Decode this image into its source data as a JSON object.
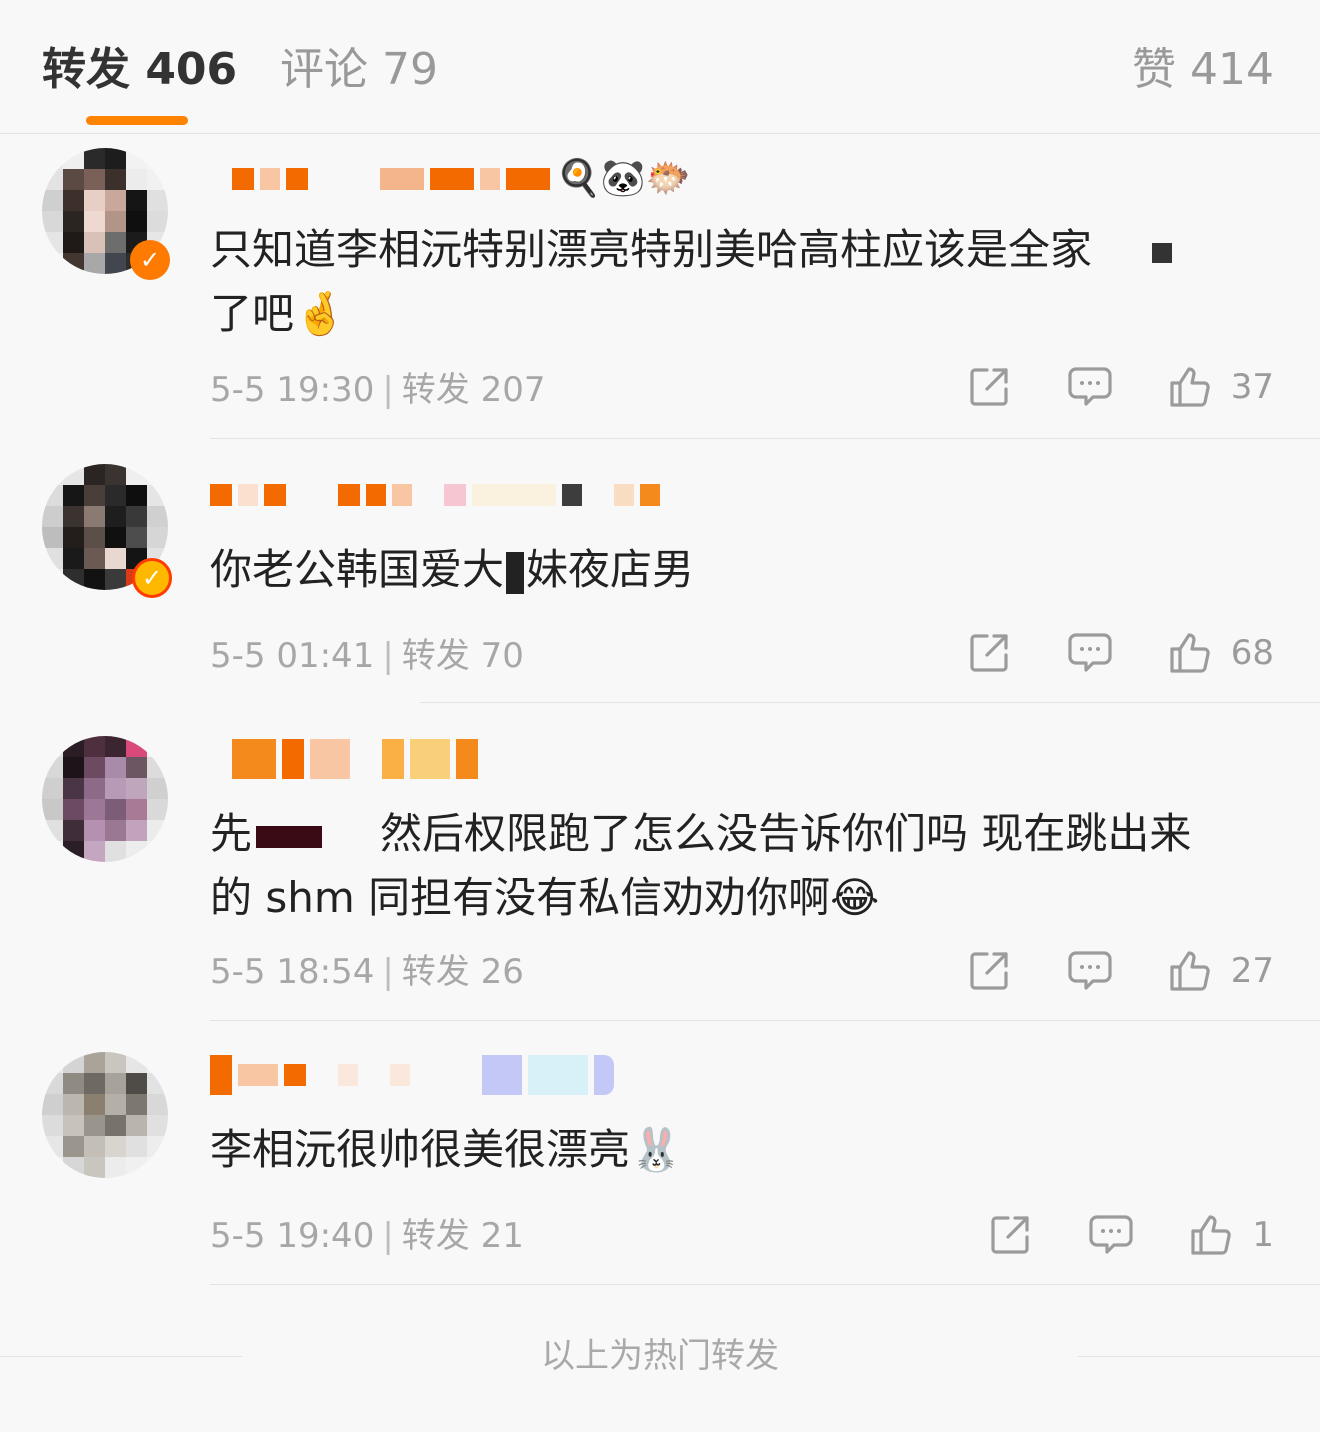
{
  "tabs": {
    "repost": "转发 406",
    "comment": "评论 79",
    "like": "赞 414"
  },
  "accent_color": "#ff8200",
  "reposts": [
    {
      "text": "只知道李相沅特别漂亮特别美哈高柱应该是全家",
      "text_tail": "了吧",
      "emoji": "🤞",
      "name_emojis": "🍳🐼🐡",
      "time": "5-5 19:30",
      "repost_count": "转发 207",
      "likes": "37"
    },
    {
      "text": "你老公韩国爱大",
      "text_tail": "妹夜店男",
      "emoji": "",
      "name_emojis": "",
      "time": "5-5 01:41",
      "repost_count": "转发 70",
      "likes": "68"
    },
    {
      "text": "先",
      "text_tail": "然后权限跑了怎么没告诉你们吗 现在跳出来",
      "text_line2": "的 shm 同担有没有私信劝劝你啊",
      "emoji": "😂",
      "name_emojis": "",
      "time": "5-5 18:54",
      "repost_count": "转发 26",
      "likes": "27"
    },
    {
      "text": "李相沅很帅很美很漂亮",
      "text_tail": "",
      "emoji": "🐰",
      "name_emojis": "",
      "time": "5-5 19:40",
      "repost_count": "转发 21",
      "likes": "1"
    }
  ],
  "icons": {
    "share": "share-icon",
    "comment": "comment-icon",
    "like": "thumbs-up-icon"
  },
  "footer": "以上为热门转发"
}
